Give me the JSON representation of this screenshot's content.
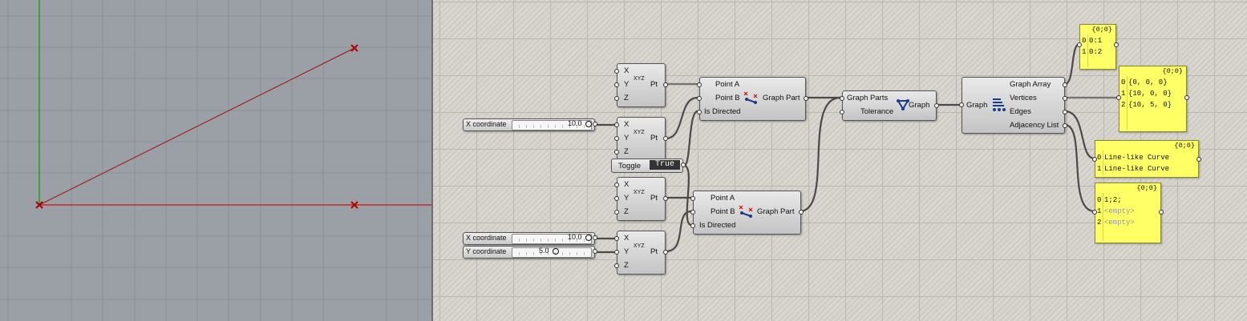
{
  "viewport": {
    "axis_colors": {
      "y": "#1fa01f",
      "x": "#cc1111"
    },
    "point_color": "#b00000"
  },
  "sliders": [
    {
      "label": "X coordinate",
      "value": "10.0"
    },
    {
      "label": "X coordinate",
      "value": "10.0"
    },
    {
      "label": "Y coordinate",
      "value": "5.0"
    }
  ],
  "toggle": {
    "label": "Toggle",
    "value": "True"
  },
  "pt_components": [
    {
      "inputs": [
        "X",
        "Y",
        "Z"
      ],
      "output": "Pt",
      "icon_text": "XYZ"
    },
    {
      "inputs": [
        "X",
        "Y",
        "Z"
      ],
      "output": "Pt",
      "icon_text": "XYZ"
    },
    {
      "inputs": [
        "X",
        "Y",
        "Z"
      ],
      "output": "Pt",
      "icon_text": "XYZ"
    },
    {
      "inputs": [
        "X",
        "Y",
        "Z"
      ],
      "output": "Pt",
      "icon_text": "XYZ"
    }
  ],
  "graph_part_components": [
    {
      "inputs": [
        "Point A",
        "Point B",
        "Is Directed"
      ],
      "output": "Graph Part"
    },
    {
      "inputs": [
        "Point A",
        "Point B",
        "Is Directed"
      ],
      "output": "Graph Part"
    }
  ],
  "graph_component": {
    "inputs": [
      "Graph Parts",
      "Tolerance"
    ],
    "output": "Graph"
  },
  "deconstruct_component": {
    "input": "Graph",
    "outputs": [
      "Graph Array",
      "Vertices",
      "Edges",
      "Adjacency List"
    ]
  },
  "panels": [
    {
      "header": "{0;0}",
      "rows": [
        [
          "0",
          "0:1"
        ],
        [
          "1",
          "0:2"
        ]
      ]
    },
    {
      "header": "{0;0}",
      "rows": [
        [
          "0",
          "{0, 0, 0}"
        ],
        [
          "1",
          "{10, 0, 0}"
        ],
        [
          "2",
          "{10, 5, 0}"
        ]
      ]
    },
    {
      "header": "{0;0}",
      "rows": [
        [
          "0",
          "Line-like Curve"
        ],
        [
          "1",
          "Line-like Curve"
        ]
      ]
    },
    {
      "header": "{0;0}",
      "rows": [
        [
          "0",
          "1;2;"
        ],
        [
          "1",
          "<empty>"
        ],
        [
          "2",
          "<empty>"
        ]
      ]
    }
  ]
}
